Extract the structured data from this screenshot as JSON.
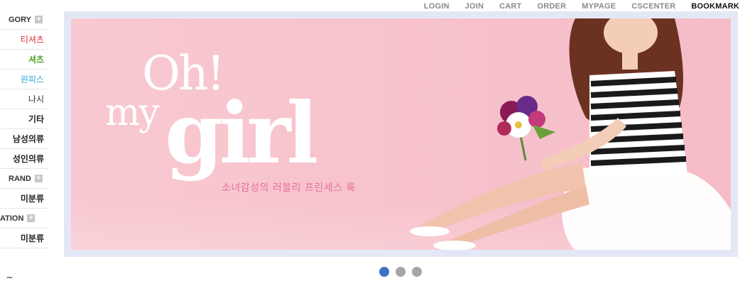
{
  "top_nav": {
    "login": "LOGIN",
    "join": "JOIN",
    "cart": "CART",
    "order": "ORDER",
    "mypage": "MYPAGE",
    "cscenter": "CSCENTER",
    "bookmark": "BOOKMARK"
  },
  "sidebar": {
    "items": [
      {
        "label": "GORY"
      },
      {
        "label": "티셔츠"
      },
      {
        "label": "셔츠"
      },
      {
        "label": "원피스"
      },
      {
        "label": "나시"
      },
      {
        "label": "기타"
      },
      {
        "label": "남성의류"
      },
      {
        "label": "성인의류"
      },
      {
        "label": "RAND"
      },
      {
        "label": "미분류"
      },
      {
        "label": "ATION"
      },
      {
        "label": "미분류"
      }
    ],
    "plus_symbol": "+"
  },
  "banner": {
    "headline_line1": "Oh!",
    "headline_line2": "my",
    "headline_line3": "girl",
    "subtitle": "소녀감성의 러블리 프린세스 룩"
  },
  "slider": {
    "slide_count": 3,
    "active_index": 0
  },
  "colors": {
    "banner_bg": "#f7c3cc",
    "frame": "#e4e8f6",
    "active_dot": "#3f72c4",
    "inactive_dot": "#a6a6a6",
    "red_item": "#e0262a",
    "green_item": "#4ca11c",
    "cyan_item": "#31a8d3"
  }
}
